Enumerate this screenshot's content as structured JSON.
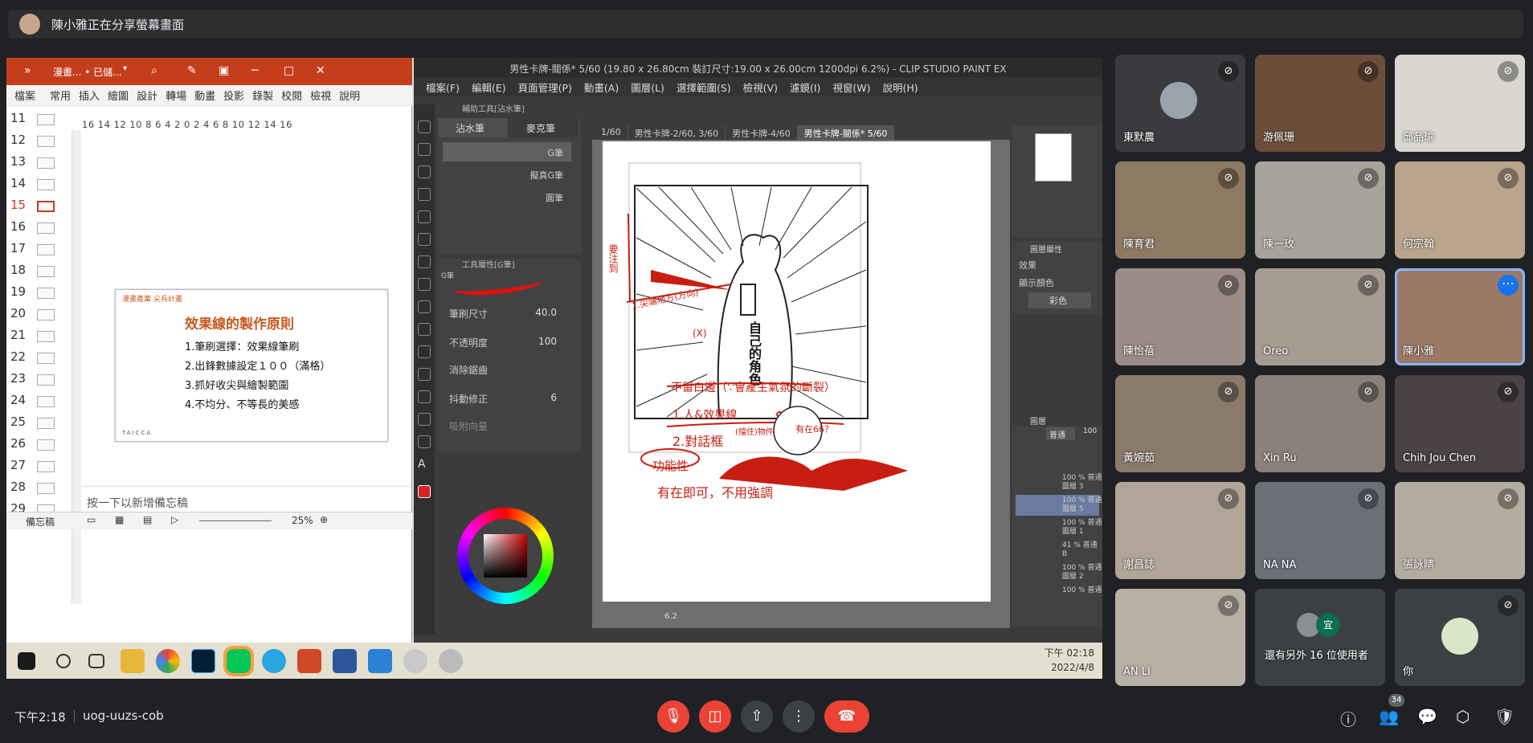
{
  "banner": {
    "text": "陳小雅正在分享螢幕畫面"
  },
  "ppt": {
    "title": "漫畫... • 已儲...",
    "menu": [
      "檔案",
      "常用",
      "插入",
      "繪圖",
      "設計",
      "轉場",
      "動畫",
      "投影",
      "錄製",
      "校閱",
      "檢視",
      "說明"
    ],
    "ruler": "16 14 12 10 8 6 4 2 0 2 4 6 8 10 12 14 16",
    "slide_numbers": [
      "11",
      "12",
      "13",
      "14",
      "15",
      "16",
      "17",
      "18",
      "19",
      "20",
      "21",
      "22",
      "23",
      "24",
      "25",
      "26",
      "27",
      "28",
      "29"
    ],
    "current_slide": "15",
    "slide": {
      "tag": "漫畫產業 尖兵計畫",
      "heading": "效果線的製作原則",
      "items": [
        "1.筆刷選擇：效果線筆刷",
        "2.出鋒數據設定１００（滿格）",
        "3.抓好收尖與繪製範圍",
        "4.不均分、不等長的美感"
      ],
      "logos": "TAICCA"
    },
    "notes_placeholder": "按一下以新增備忘稿",
    "status": {
      "notes_label": "備忘稿",
      "zoom": "25%"
    }
  },
  "csp": {
    "title": "男性卡牌-關係* 5/60 (19.80 x 26.80cm 裝訂尺寸:19.00 x 26.00cm 1200dpi 6.2%) - CLIP STUDIO PAINT EX",
    "menu": [
      "檔案(F)",
      "編輯(E)",
      "頁面管理(P)",
      "動畫(A)",
      "圖層(L)",
      "選擇範圍(S)",
      "檢視(V)",
      "濾鏡(I)",
      "視窗(W)",
      "說明(H)"
    ],
    "tabs": [
      "1/60",
      "男性卡牌-2/60, 3/60",
      "男性卡牌-4/60",
      "男性卡牌-關係* 5/60"
    ],
    "subtool_panel": "輔助工具[沾水筆]",
    "subtool_tabs": [
      "沾水筆",
      "麥克筆"
    ],
    "brushes": [
      "G筆",
      "擬真G筆",
      "圓筆"
    ],
    "toolprop_panel": "工具屬性[G筆]",
    "toolprop_brush": "G筆",
    "props": [
      {
        "label": "筆刷尺寸",
        "value": "40.0"
      },
      {
        "label": "不透明度",
        "value": "100"
      },
      {
        "label": "消除鋸齒",
        "value": ""
      },
      {
        "label": "抖動修正",
        "value": "6"
      },
      {
        "label": "吸附向量",
        "value": ""
      }
    ],
    "layer_prop_panel": "圖層屬性",
    "effect_label": "效果",
    "display_color_label": "顯示顏色",
    "display_color_value": "彩色",
    "layer_panel": "圖層",
    "blend_mode": "普通",
    "opacity": "100",
    "zoom_value": "6.2",
    "layers": [
      {
        "name": "100 % 普通\n圖層 3"
      },
      {
        "name": "100 % 普通\n圖層 5"
      },
      {
        "name": "100 % 普通\n圖層 1"
      },
      {
        "name": "41 % 普通\nB"
      },
      {
        "name": "100 % 普通\n圖層 2"
      },
      {
        "name": "100 % 普通"
      }
    ],
    "selected_layer": 1
  },
  "drawing": {
    "vertical_text": "自己的角色",
    "red_notes": [
      "1.尖端地方(方向)",
      "(X)",
      "要注到"
    ],
    "lower_notes": [
      "不留白邊（∵會產生氣氛的斷裂）",
      "1.人&效果線",
      "2.對話框",
      "(擋住)物件",
      "有在66？",
      "功能性",
      "有在即可，不用強調"
    ]
  },
  "taskbar": {
    "time": "下午 02:18",
    "date": "2022/4/8"
  },
  "participants": [
    {
      "name": "東默農",
      "muted": true
    },
    {
      "name": "游佩珊",
      "muted": true
    },
    {
      "name": "邱品瑜",
      "muted": true
    },
    {
      "name": "陳育君",
      "muted": true
    },
    {
      "name": "陳一玫",
      "muted": true
    },
    {
      "name": "何宗翰",
      "muted": true
    },
    {
      "name": "陳怡蓓",
      "muted": true
    },
    {
      "name": "Oreo",
      "muted": true
    },
    {
      "name": "陳小雅",
      "muted": false
    },
    {
      "name": "黃婉茹",
      "muted": true
    },
    {
      "name": "Xin Ru",
      "muted": true
    },
    {
      "name": "Chih Jou Chen",
      "muted": true
    },
    {
      "name": "謝昌誌",
      "muted": true
    },
    {
      "name": "NA NA",
      "muted": true
    },
    {
      "name": "張詠晴",
      "muted": true
    },
    {
      "name": "AN LI",
      "muted": true
    },
    {
      "name": "還有另外 16 位使用者",
      "muted": false
    },
    {
      "name": "你",
      "muted": true
    }
  ],
  "others_badge": "宜",
  "meeting": {
    "time": "下午2:18",
    "code": "uog-uuzs-cob",
    "people_count": "34"
  },
  "colors": {
    "ppt_red": "#c43e1c",
    "meet_bg": "#202124",
    "end_call": "#ea4335",
    "active": "#8ab4f8"
  }
}
